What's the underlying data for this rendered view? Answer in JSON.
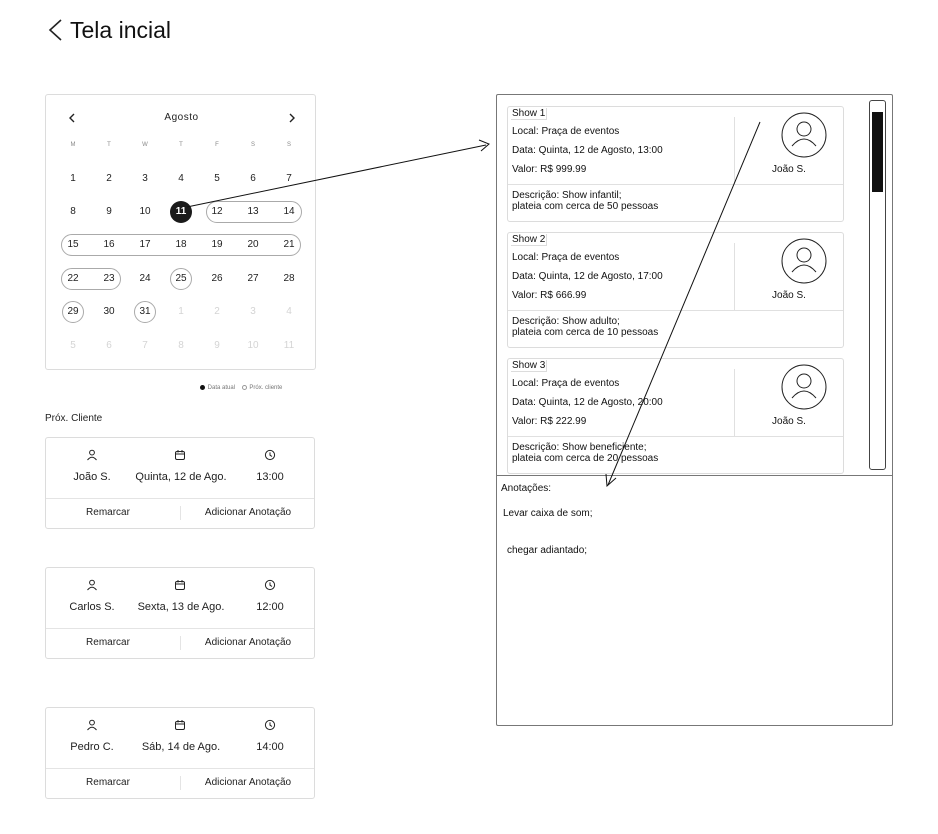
{
  "header": {
    "title": "Tela incial"
  },
  "calendar": {
    "month": "Agosto",
    "weekdays": [
      "M",
      "T",
      "W",
      "T",
      "F",
      "S",
      "S"
    ],
    "weeks": [
      [
        "1",
        "2",
        "3",
        "4",
        "5",
        "6",
        "7"
      ],
      [
        "8",
        "9",
        "10",
        "11",
        "12",
        "13",
        "14"
      ],
      [
        "15",
        "16",
        "17",
        "18",
        "19",
        "20",
        "21"
      ],
      [
        "22",
        "23",
        "24",
        "25",
        "26",
        "27",
        "28"
      ],
      [
        "29",
        "30",
        "31",
        "1",
        "2",
        "3",
        "4"
      ],
      [
        "5",
        "6",
        "7",
        "8",
        "9",
        "10",
        "11"
      ]
    ],
    "current_date": "11",
    "legend_current": "Data atual",
    "legend_client": "Próx. cliente"
  },
  "next_clients": {
    "label": "Próx. Cliente",
    "items": [
      {
        "name": "João S.",
        "date": "Quinta, 12 de Ago.",
        "time": "13:00",
        "reschedule": "Remarcar",
        "add_note": "Adicionar Anotação"
      },
      {
        "name": "Carlos S.",
        "date": "Sexta, 13 de Ago.",
        "time": "12:00",
        "reschedule": "Remarcar",
        "add_note": "Adicionar Anotação"
      },
      {
        "name": "Pedro C.",
        "date": "Sáb, 14 de Ago.",
        "time": "14:00",
        "reschedule": "Remarcar",
        "add_note": "Adicionar Anotação"
      }
    ]
  },
  "shows": [
    {
      "title": "Show 1",
      "local": "Local: Praça de eventos",
      "date": "Data: Quinta, 12 de Agosto, 13:00",
      "value": "Valor: R$ 999.99",
      "person": "João S.",
      "description": "Descrição: Show infantil;\nplateia com cerca de 50 pessoas"
    },
    {
      "title": "Show 2",
      "local": "Local: Praça de eventos",
      "date": "Data: Quinta, 12 de Agosto, 17:00",
      "value": "Valor: R$ 666.99",
      "person": "João S.",
      "description": "Descrição: Show adulto;\nplateia com cerca de 10 pessoas"
    },
    {
      "title": "Show 3",
      "local": "Local: Praça de eventos",
      "date": "Data: Quinta, 12 de Agosto, 20:00",
      "value": "Valor: R$ 222.99",
      "person": "João S.",
      "description": "Descrição: Show beneficiente;\nplateia com cerca de 20 pessoas"
    }
  ],
  "notes": {
    "label": "Anotações:",
    "lines": [
      "Levar caixa de som;",
      "chegar adiantado;"
    ]
  },
  "icons": {
    "back": "chevron-left-icon",
    "prev_month": "chevron-left-icon",
    "next_month": "chevron-right-icon",
    "client": "user-icon",
    "date": "calendar-icon",
    "time": "clock-icon",
    "avatar": "user-avatar-icon"
  }
}
